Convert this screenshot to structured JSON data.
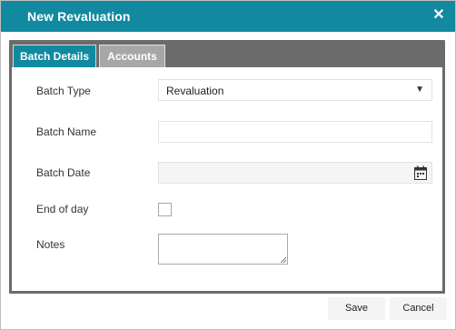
{
  "dialog": {
    "title": "New Revaluation",
    "close_icon": "close-icon"
  },
  "tabs": [
    {
      "label": "Batch Details",
      "active": true
    },
    {
      "label": "Accounts",
      "active": false
    }
  ],
  "form": {
    "batch_type": {
      "label": "Batch Type",
      "value": "Revaluation"
    },
    "batch_name": {
      "label": "Batch Name",
      "value": ""
    },
    "batch_date": {
      "label": "Batch Date",
      "value": "",
      "icon": "calendar-icon"
    },
    "end_of_day": {
      "label": "End of day",
      "checked": false
    },
    "notes": {
      "label": "Notes",
      "value": ""
    }
  },
  "buttons": {
    "save": "Save",
    "cancel": "Cancel"
  },
  "colors": {
    "accent": "#1189a0",
    "tab_frame": "#6b6b6b",
    "inactive_tab": "#a7a7a7"
  }
}
